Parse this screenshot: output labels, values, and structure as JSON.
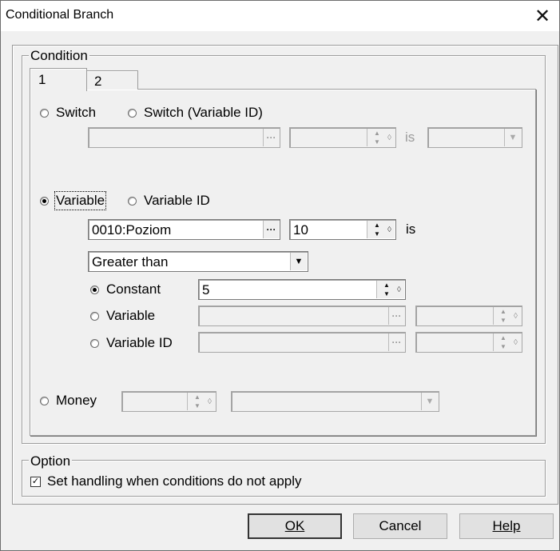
{
  "window": {
    "title": "Conditional Branch",
    "close_glyph": "✕"
  },
  "condition_group": {
    "label": "Condition"
  },
  "tabs": [
    {
      "label": "1"
    },
    {
      "label": "2"
    }
  ],
  "switch_row": {
    "switch_label": "Switch",
    "switch_varid_label": "Switch (Variable ID)",
    "switch_value": "",
    "switch_spin_value": "",
    "is_label": "is",
    "state_value": ""
  },
  "variable_row": {
    "variable_label": "Variable",
    "variable_id_label": "Variable ID",
    "variable_value": "0010:Poziom",
    "variable_spin_value": "10",
    "is_label": "is",
    "operator_value": "Greater than"
  },
  "operand": {
    "constant_label": "Constant",
    "constant_value": "5",
    "variable_label": "Variable",
    "variable_value": "",
    "variable_spin_value": "",
    "variable_id_label": "Variable ID",
    "variable_id_value": "",
    "variable_id_spin_value": ""
  },
  "money_row": {
    "money_label": "Money",
    "money_value": "",
    "compare_value": ""
  },
  "option_group": {
    "label": "Option",
    "handling_label": "Set handling when conditions do not apply",
    "handling_checked": true
  },
  "buttons": {
    "ok": "OK",
    "cancel": "Cancel",
    "help": "Help"
  },
  "selected": {
    "condition_type": "Variable",
    "operand_type": "Constant",
    "active_tab": "1"
  }
}
